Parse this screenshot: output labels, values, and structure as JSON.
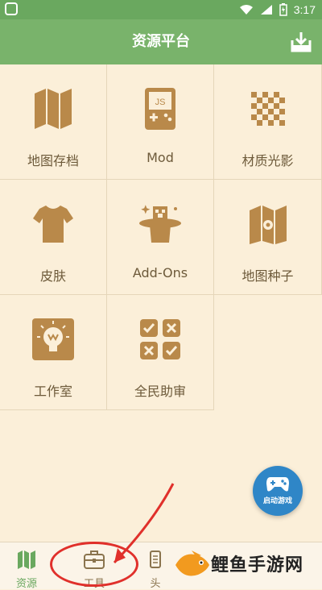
{
  "status_bar": {
    "time": "3:17"
  },
  "app_bar": {
    "title": "资源平台"
  },
  "grid": [
    {
      "label": "地图存档",
      "icon": "map-icon"
    },
    {
      "label": "Mod",
      "icon": "js-gameboy-icon"
    },
    {
      "label": "材质光影",
      "icon": "checker-texture-icon"
    },
    {
      "label": "皮肤",
      "icon": "tshirt-icon"
    },
    {
      "label": "Add-Ons",
      "icon": "magic-hat-icon"
    },
    {
      "label": "地图种子",
      "icon": "map-pin-icon"
    },
    {
      "label": "工作室",
      "icon": "lightbulb-icon"
    },
    {
      "label": "全民助审",
      "icon": "review-checks-icon"
    }
  ],
  "fab": {
    "label": "启动游戏"
  },
  "bottom_nav": [
    {
      "label": "资源",
      "active": true
    },
    {
      "label": "工具",
      "active": false
    },
    {
      "label": "头",
      "active": false
    }
  ],
  "watermark": {
    "text": "鲤鱼手游网"
  },
  "colors": {
    "primary_green": "#79b36b",
    "background": "#fbefd9",
    "icon_brown": "#b9894a",
    "label_brown": "#6d5a3a",
    "fab_blue": "#2f86c7",
    "annotation_red": "#e0302b"
  }
}
